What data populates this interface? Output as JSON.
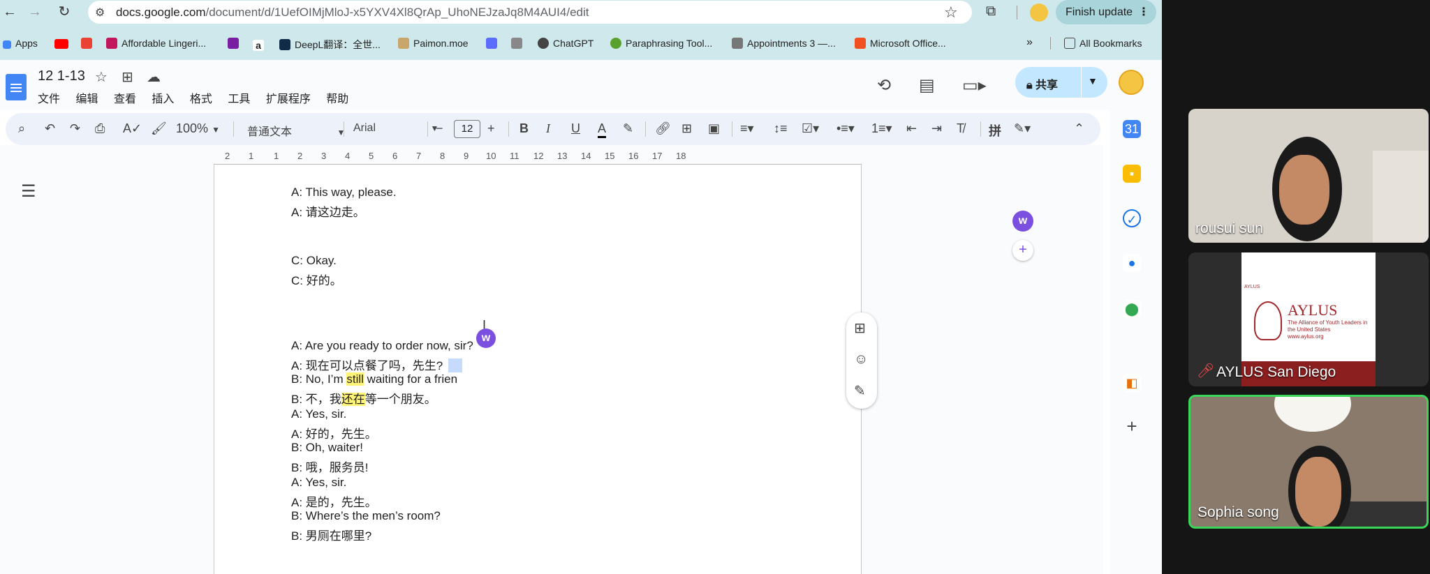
{
  "browser": {
    "url_host": "docs.google.com",
    "url_path": "/document/d/1UefOIMjMloJ-x5YXV4Xl8QrAp_UhoNEJzaJq8M4AUI4/edit",
    "finish_update_label": "Finish update",
    "bookmarks": [
      {
        "label": "Apps",
        "color": "#4285f4"
      },
      {
        "label": "",
        "color": "#ff0000"
      },
      {
        "label": "",
        "color": "#ea4335"
      },
      {
        "label": "Affordable Lingeri...",
        "color": "#c2185b"
      },
      {
        "label": "",
        "color": "#7b1fa2"
      },
      {
        "label": "",
        "color": "#222222"
      },
      {
        "label": "DeepL翻译：全世...",
        "color": "#0f2b46"
      },
      {
        "label": "Paimon.moe",
        "color": "#c9a66b"
      },
      {
        "label": "",
        "color": "#5b6cff"
      },
      {
        "label": "",
        "color": "#888888"
      },
      {
        "label": "ChatGPT",
        "color": "#444444"
      },
      {
        "label": "Paraphrasing Tool...",
        "color": "#5aa02c"
      },
      {
        "label": "Appointments 3 —...",
        "color": "#777777"
      },
      {
        "label": "Microsoft Office...",
        "color": "#f25022"
      }
    ],
    "all_bookmarks_label": "All Bookmarks",
    "more_bookmarks": "»"
  },
  "docs": {
    "title": "12 1-13",
    "menu": [
      "文件",
      "编辑",
      "查看",
      "插入",
      "格式",
      "工具",
      "扩展程序",
      "帮助"
    ],
    "share_label": "共享",
    "toolbar": {
      "zoom": "100%",
      "style": "普通文本",
      "font": "Arial",
      "font_size": "12"
    },
    "ruler_numbers": [
      "2",
      "1",
      "1",
      "2",
      "3",
      "4",
      "5",
      "6",
      "7",
      "8",
      "9",
      "10",
      "11",
      "12",
      "13",
      "14",
      "15",
      "16",
      "17",
      "18"
    ],
    "lines": [
      {
        "text": "A: This way, please."
      },
      {
        "text": "A: 请这边走。"
      },
      {
        "text": "C: Okay."
      },
      {
        "text": "C: 好的。"
      },
      {
        "text": "A: Are you ready to order now, sir?"
      },
      {
        "pre": "A: 现在可以点餐了吗，先生?"
      },
      {
        "pre": "B: No, I’m ",
        "hl": "still",
        "post": " waiting for a frien"
      },
      {
        "pre": "B: 不，我",
        "hl": "还在",
        "post": "等一个朋友。"
      },
      {
        "text": "A: Yes, sir."
      },
      {
        "text": "A: 好的，先生。"
      },
      {
        "text": "B: Oh, waiter!"
      },
      {
        "text": "B: 哦，服务员!"
      },
      {
        "text": "A: Yes, sir."
      },
      {
        "text": "A: 是的，先生。"
      },
      {
        "text": "B: Where’s the men’s room?"
      },
      {
        "text": "B: 男厕在哪里?"
      }
    ]
  },
  "video": {
    "participants": [
      {
        "name": "rousui sun"
      },
      {
        "name": "AYLUS San Diego",
        "muted": true
      },
      {
        "name": "Sophia song",
        "active_speaker": true
      }
    ],
    "slide": {
      "small_logo": "AYLUS",
      "title": "AYLUS",
      "subtitle": "The Alliance of Youth Leaders in the United States",
      "url": "www.aylus.org"
    }
  }
}
